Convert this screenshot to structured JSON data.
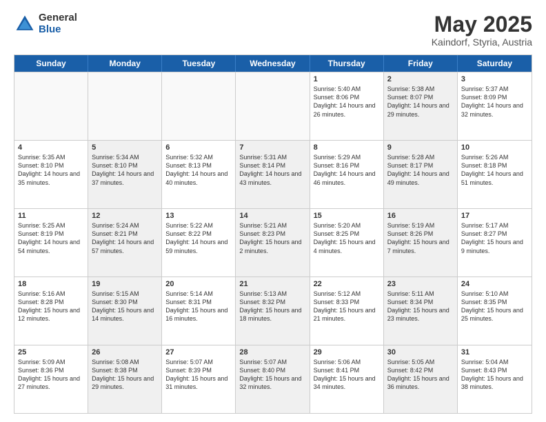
{
  "logo": {
    "general": "General",
    "blue": "Blue"
  },
  "title": "May 2025",
  "subtitle": "Kaindorf, Styria, Austria",
  "header_days": [
    "Sunday",
    "Monday",
    "Tuesday",
    "Wednesday",
    "Thursday",
    "Friday",
    "Saturday"
  ],
  "weeks": [
    [
      {
        "day": "",
        "sunrise": "",
        "sunset": "",
        "daylight": "",
        "shaded": false,
        "empty": true
      },
      {
        "day": "",
        "sunrise": "",
        "sunset": "",
        "daylight": "",
        "shaded": false,
        "empty": true
      },
      {
        "day": "",
        "sunrise": "",
        "sunset": "",
        "daylight": "",
        "shaded": false,
        "empty": true
      },
      {
        "day": "",
        "sunrise": "",
        "sunset": "",
        "daylight": "",
        "shaded": false,
        "empty": true
      },
      {
        "day": "1",
        "sunrise": "Sunrise: 5:40 AM",
        "sunset": "Sunset: 8:06 PM",
        "daylight": "Daylight: 14 hours and 26 minutes.",
        "shaded": false,
        "empty": false
      },
      {
        "day": "2",
        "sunrise": "Sunrise: 5:38 AM",
        "sunset": "Sunset: 8:07 PM",
        "daylight": "Daylight: 14 hours and 29 minutes.",
        "shaded": true,
        "empty": false
      },
      {
        "day": "3",
        "sunrise": "Sunrise: 5:37 AM",
        "sunset": "Sunset: 8:09 PM",
        "daylight": "Daylight: 14 hours and 32 minutes.",
        "shaded": false,
        "empty": false
      }
    ],
    [
      {
        "day": "4",
        "sunrise": "Sunrise: 5:35 AM",
        "sunset": "Sunset: 8:10 PM",
        "daylight": "Daylight: 14 hours and 35 minutes.",
        "shaded": false,
        "empty": false
      },
      {
        "day": "5",
        "sunrise": "Sunrise: 5:34 AM",
        "sunset": "Sunset: 8:10 PM",
        "daylight": "Daylight: 14 hours and 37 minutes.",
        "shaded": true,
        "empty": false
      },
      {
        "day": "6",
        "sunrise": "Sunrise: 5:32 AM",
        "sunset": "Sunset: 8:13 PM",
        "daylight": "Daylight: 14 hours and 40 minutes.",
        "shaded": false,
        "empty": false
      },
      {
        "day": "7",
        "sunrise": "Sunrise: 5:31 AM",
        "sunset": "Sunset: 8:14 PM",
        "daylight": "Daylight: 14 hours and 43 minutes.",
        "shaded": true,
        "empty": false
      },
      {
        "day": "8",
        "sunrise": "Sunrise: 5:29 AM",
        "sunset": "Sunset: 8:16 PM",
        "daylight": "Daylight: 14 hours and 46 minutes.",
        "shaded": false,
        "empty": false
      },
      {
        "day": "9",
        "sunrise": "Sunrise: 5:28 AM",
        "sunset": "Sunset: 8:17 PM",
        "daylight": "Daylight: 14 hours and 49 minutes.",
        "shaded": true,
        "empty": false
      },
      {
        "day": "10",
        "sunrise": "Sunrise: 5:26 AM",
        "sunset": "Sunset: 8:18 PM",
        "daylight": "Daylight: 14 hours and 51 minutes.",
        "shaded": false,
        "empty": false
      }
    ],
    [
      {
        "day": "11",
        "sunrise": "Sunrise: 5:25 AM",
        "sunset": "Sunset: 8:19 PM",
        "daylight": "Daylight: 14 hours and 54 minutes.",
        "shaded": false,
        "empty": false
      },
      {
        "day": "12",
        "sunrise": "Sunrise: 5:24 AM",
        "sunset": "Sunset: 8:21 PM",
        "daylight": "Daylight: 14 hours and 57 minutes.",
        "shaded": true,
        "empty": false
      },
      {
        "day": "13",
        "sunrise": "Sunrise: 5:22 AM",
        "sunset": "Sunset: 8:22 PM",
        "daylight": "Daylight: 14 hours and 59 minutes.",
        "shaded": false,
        "empty": false
      },
      {
        "day": "14",
        "sunrise": "Sunrise: 5:21 AM",
        "sunset": "Sunset: 8:23 PM",
        "daylight": "Daylight: 15 hours and 2 minutes.",
        "shaded": true,
        "empty": false
      },
      {
        "day": "15",
        "sunrise": "Sunrise: 5:20 AM",
        "sunset": "Sunset: 8:25 PM",
        "daylight": "Daylight: 15 hours and 4 minutes.",
        "shaded": false,
        "empty": false
      },
      {
        "day": "16",
        "sunrise": "Sunrise: 5:19 AM",
        "sunset": "Sunset: 8:26 PM",
        "daylight": "Daylight: 15 hours and 7 minutes.",
        "shaded": true,
        "empty": false
      },
      {
        "day": "17",
        "sunrise": "Sunrise: 5:17 AM",
        "sunset": "Sunset: 8:27 PM",
        "daylight": "Daylight: 15 hours and 9 minutes.",
        "shaded": false,
        "empty": false
      }
    ],
    [
      {
        "day": "18",
        "sunrise": "Sunrise: 5:16 AM",
        "sunset": "Sunset: 8:28 PM",
        "daylight": "Daylight: 15 hours and 12 minutes.",
        "shaded": false,
        "empty": false
      },
      {
        "day": "19",
        "sunrise": "Sunrise: 5:15 AM",
        "sunset": "Sunset: 8:30 PM",
        "daylight": "Daylight: 15 hours and 14 minutes.",
        "shaded": true,
        "empty": false
      },
      {
        "day": "20",
        "sunrise": "Sunrise: 5:14 AM",
        "sunset": "Sunset: 8:31 PM",
        "daylight": "Daylight: 15 hours and 16 minutes.",
        "shaded": false,
        "empty": false
      },
      {
        "day": "21",
        "sunrise": "Sunrise: 5:13 AM",
        "sunset": "Sunset: 8:32 PM",
        "daylight": "Daylight: 15 hours and 18 minutes.",
        "shaded": true,
        "empty": false
      },
      {
        "day": "22",
        "sunrise": "Sunrise: 5:12 AM",
        "sunset": "Sunset: 8:33 PM",
        "daylight": "Daylight: 15 hours and 21 minutes.",
        "shaded": false,
        "empty": false
      },
      {
        "day": "23",
        "sunrise": "Sunrise: 5:11 AM",
        "sunset": "Sunset: 8:34 PM",
        "daylight": "Daylight: 15 hours and 23 minutes.",
        "shaded": true,
        "empty": false
      },
      {
        "day": "24",
        "sunrise": "Sunrise: 5:10 AM",
        "sunset": "Sunset: 8:35 PM",
        "daylight": "Daylight: 15 hours and 25 minutes.",
        "shaded": false,
        "empty": false
      }
    ],
    [
      {
        "day": "25",
        "sunrise": "Sunrise: 5:09 AM",
        "sunset": "Sunset: 8:36 PM",
        "daylight": "Daylight: 15 hours and 27 minutes.",
        "shaded": false,
        "empty": false
      },
      {
        "day": "26",
        "sunrise": "Sunrise: 5:08 AM",
        "sunset": "Sunset: 8:38 PM",
        "daylight": "Daylight: 15 hours and 29 minutes.",
        "shaded": true,
        "empty": false
      },
      {
        "day": "27",
        "sunrise": "Sunrise: 5:07 AM",
        "sunset": "Sunset: 8:39 PM",
        "daylight": "Daylight: 15 hours and 31 minutes.",
        "shaded": false,
        "empty": false
      },
      {
        "day": "28",
        "sunrise": "Sunrise: 5:07 AM",
        "sunset": "Sunset: 8:40 PM",
        "daylight": "Daylight: 15 hours and 32 minutes.",
        "shaded": true,
        "empty": false
      },
      {
        "day": "29",
        "sunrise": "Sunrise: 5:06 AM",
        "sunset": "Sunset: 8:41 PM",
        "daylight": "Daylight: 15 hours and 34 minutes.",
        "shaded": false,
        "empty": false
      },
      {
        "day": "30",
        "sunrise": "Sunrise: 5:05 AM",
        "sunset": "Sunset: 8:42 PM",
        "daylight": "Daylight: 15 hours and 36 minutes.",
        "shaded": true,
        "empty": false
      },
      {
        "day": "31",
        "sunrise": "Sunrise: 5:04 AM",
        "sunset": "Sunset: 8:43 PM",
        "daylight": "Daylight: 15 hours and 38 minutes.",
        "shaded": false,
        "empty": false
      }
    ]
  ]
}
